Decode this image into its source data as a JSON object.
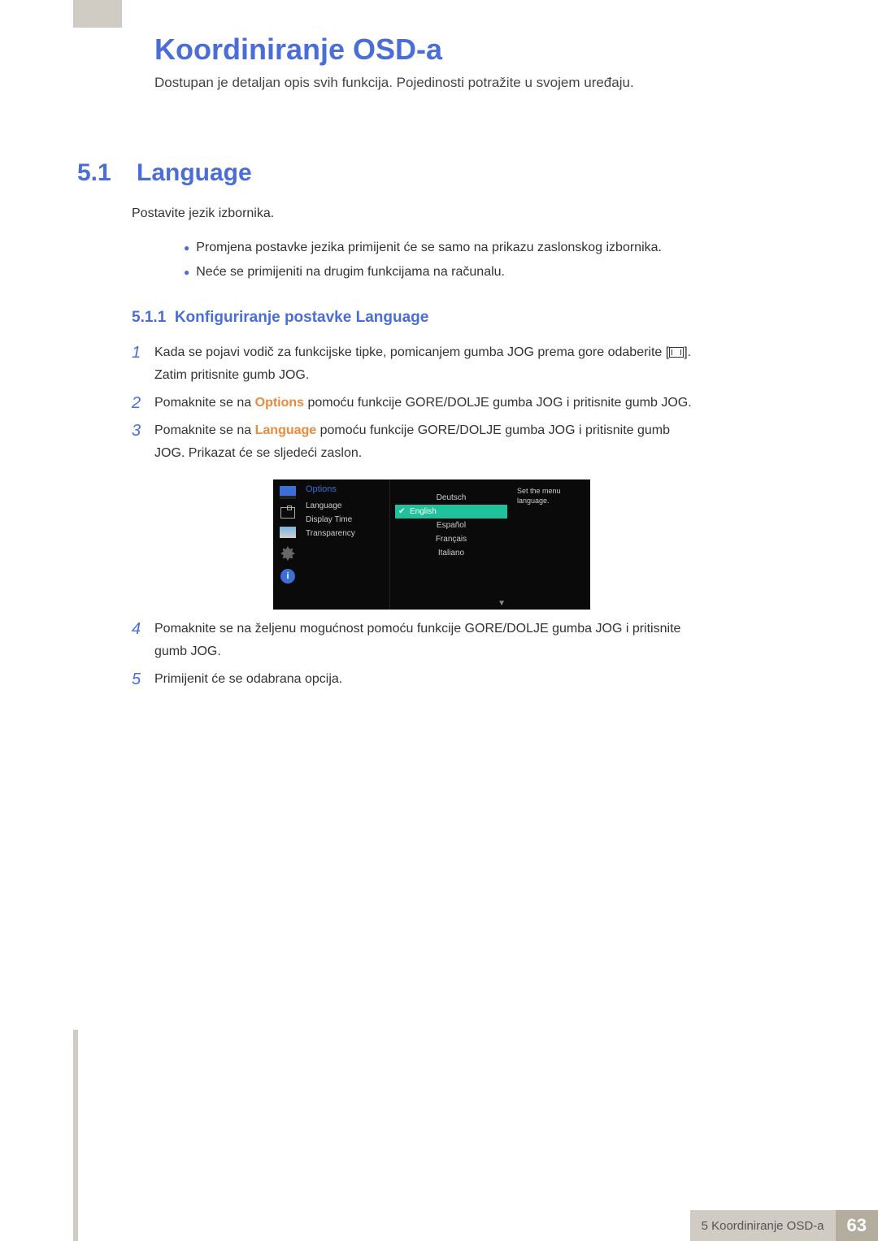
{
  "page_title": "Koordiniranje OSD-a",
  "intro": "Dostupan je detaljan opis svih funkcija. Pojedinosti potražite u svojem uređaju.",
  "section_number": "5.1",
  "section_title": "Language",
  "description": "Postavite jezik izbornika.",
  "bullets": [
    "Promjena postavke jezika primijenit će se samo na prikazu zaslonskog izbornika.",
    "Neće se primijeniti na drugim funkcijama na računalu."
  ],
  "subheading_num": "5.1.1",
  "subheading_title": "Konfiguriranje postavke Language",
  "steps": {
    "s1a": "Kada se pojavi vodič za funkcijske tipke, pomicanjem gumba JOG prema gore odaberite [",
    "s1b": "]. Zatim pritisnite gumb JOG.",
    "s2a": "Pomaknite se na ",
    "s2_hl": "Options",
    "s2b": " pomoću funkcije GORE/DOLJE gumba JOG i pritisnite gumb JOG.",
    "s3a": "Pomaknite se na ",
    "s3_hl": "Language",
    "s3b": " pomoću funkcije GORE/DOLJE gumba JOG i pritisnite gumb JOG. Prikazat će se sljedeći zaslon.",
    "s4": "Pomaknite se na željenu mogućnost pomoću funkcije GORE/DOLJE gumba JOG i pritisnite gumb JOG.",
    "s5": "Primijenit će se odabrana opcija."
  },
  "osd": {
    "header": "Options",
    "menu": [
      "Language",
      "Display Time",
      "Transparency"
    ],
    "languages": [
      "Deutsch",
      "English",
      "Español",
      "Français",
      "Italiano"
    ],
    "selected": "English",
    "help": "Set the menu language.",
    "info_glyph": "i"
  },
  "footer": {
    "label": "5 Koordiniranje OSD-a",
    "page": "63"
  }
}
